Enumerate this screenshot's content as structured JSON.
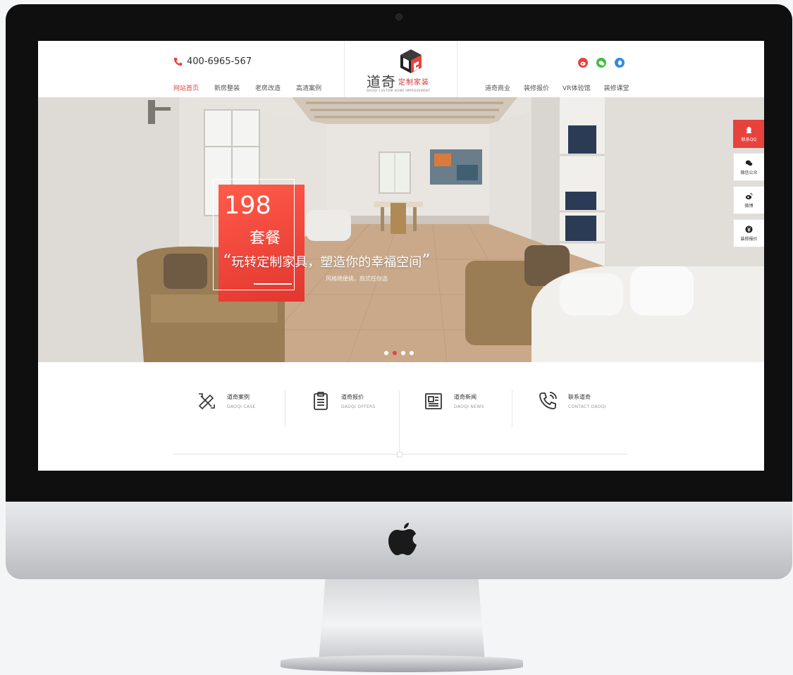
{
  "header": {
    "phone": "400-6965-567",
    "nav_left": [
      "网站首页",
      "新房整装",
      "老房改造",
      "高清案例"
    ],
    "nav_right": [
      "道奇商业",
      "装修报价",
      "VR体验馆",
      "装修课堂"
    ],
    "logo": {
      "main": "道奇",
      "sub": "定制家装",
      "en": "DAOQI CUSTOM HOME IMPROVEMENT"
    },
    "social_icons": [
      "weibo-icon",
      "wechat-icon",
      "qq-icon"
    ]
  },
  "hero": {
    "promo_number": "198",
    "promo_label": "套餐",
    "slogan": "玩转定制家具，塑造你的幸福空间",
    "slogan_sub": "风格随便挑，款式任你选",
    "dots": 4,
    "active_dot": 1
  },
  "features": [
    {
      "title": "道奇案例",
      "subtitle": "DAOQI CASE",
      "icon": "tools-icon"
    },
    {
      "title": "道奇报价",
      "subtitle": "DAOQI OFFERS",
      "icon": "clipboard-icon"
    },
    {
      "title": "道奇新闻",
      "subtitle": "DAOQI NEWS",
      "icon": "news-icon"
    },
    {
      "title": "联系道奇",
      "subtitle": "CONTACT DAOQI",
      "icon": "phone-icon"
    }
  ],
  "side_toolbar": [
    {
      "label": "联系QQ",
      "icon": "qq-icon"
    },
    {
      "label": "微信公众",
      "icon": "wechat-icon"
    },
    {
      "label": "微博",
      "icon": "weibo-icon"
    },
    {
      "label": "装修报价",
      "icon": "price-icon"
    }
  ],
  "colors": {
    "accent": "#e8423d",
    "bezel": "#0f0f10",
    "text": "#333333"
  }
}
